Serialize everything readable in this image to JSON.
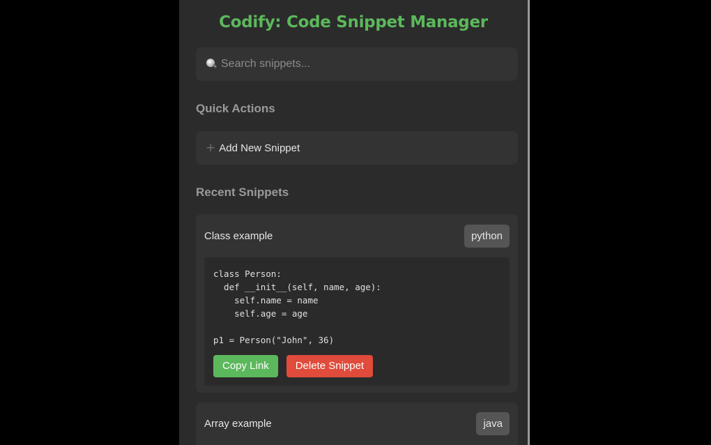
{
  "app": {
    "title": "Codify: Code Snippet Manager"
  },
  "search": {
    "placeholder": "Search snippets...",
    "icon": "magnifier-icon"
  },
  "quick_actions": {
    "heading": "Quick Actions",
    "add_label": "Add New Snippet",
    "add_icon": "plus-icon"
  },
  "recent": {
    "heading": "Recent Snippets",
    "snippets": [
      {
        "title": "Class example",
        "language": "python",
        "code": "class Person:\n  def __init__(self, name, age):\n    self.name = name\n    self.age = age\n\np1 = Person(\"John\", 36)",
        "copy_label": "Copy Link",
        "delete_label": "Delete Snippet"
      },
      {
        "title": "Array example",
        "language": "java"
      }
    ]
  },
  "colors": {
    "accent": "#5cb85c",
    "danger": "#e04b3b",
    "panel_bg": "#2b2b2b",
    "card_bg": "#333333"
  }
}
